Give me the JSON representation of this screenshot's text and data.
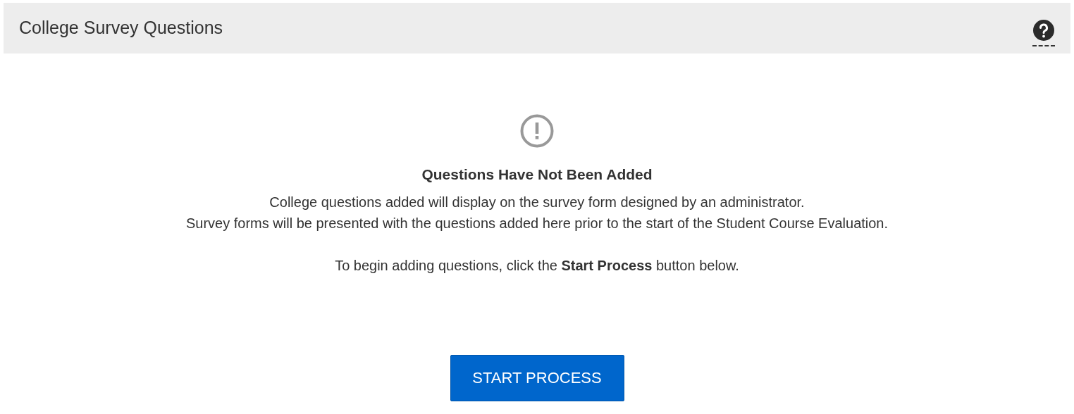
{
  "header": {
    "title": "College Survey Questions"
  },
  "empty_state": {
    "heading": "Questions Have Not Been Added",
    "lines": [
      "College questions added will display on the survey form designed by an administrator.",
      "Survey forms will be presented with the questions added here prior to the start of the Student Course Evaluation."
    ],
    "instruction": "To begin adding questions, click the **Start Process** button below."
  },
  "button": {
    "label": "START PROCESS"
  }
}
